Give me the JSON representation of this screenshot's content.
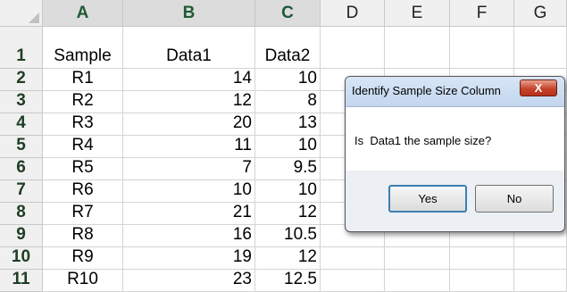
{
  "spreadsheet": {
    "column_headers": [
      "A",
      "B",
      "C",
      "D",
      "E",
      "F",
      "G"
    ],
    "row_headers": [
      "1",
      "2",
      "3",
      "4",
      "5",
      "6",
      "7",
      "8",
      "9",
      "10",
      "11"
    ],
    "rows": [
      [
        "Sample",
        "Data1",
        "Data2"
      ],
      [
        "R1",
        "14",
        "10"
      ],
      [
        "R2",
        "12",
        "8"
      ],
      [
        "R3",
        "20",
        "13"
      ],
      [
        "R4",
        "11",
        "10"
      ],
      [
        "R5",
        "7",
        "9.5"
      ],
      [
        "R6",
        "10",
        "10"
      ],
      [
        "R7",
        "21",
        "12"
      ],
      [
        "R8",
        "16",
        "10.5"
      ],
      [
        "R9",
        "19",
        "12"
      ],
      [
        "R10",
        "23",
        "12.5"
      ]
    ]
  },
  "dialog": {
    "title": "Identify Sample Size Column",
    "close_label": "X",
    "message": "Is  Data1 the sample size?",
    "yes_label": "Yes",
    "no_label": "No"
  }
}
